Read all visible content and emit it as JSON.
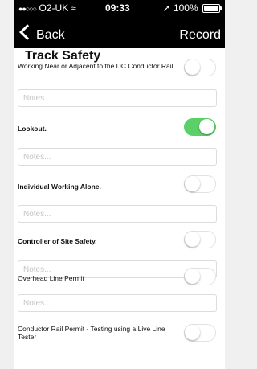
{
  "status_bar": {
    "signal_dots": "●●○○○",
    "carrier": "O2-UK",
    "wifi_glyph": "≈",
    "time": "09:33",
    "location_arrow": "➚",
    "battery": "100%"
  },
  "nav": {
    "back_label": "Back",
    "record_label": "Record"
  },
  "section": {
    "title": "Track Safety"
  },
  "items": [
    {
      "label": "Working Near or Adjacent to the DC Conductor Rail",
      "on": false,
      "notes_placeholder": "Notes..."
    },
    {
      "label": "Lookout.",
      "on": true,
      "notes_placeholder": "Notes..."
    },
    {
      "label": "Individual Working Alone.",
      "on": false,
      "notes_placeholder": "Notes..."
    },
    {
      "label": "Controller of Site Safety.",
      "on": false,
      "notes_placeholder": "Notes..."
    },
    {
      "label": "Overhead Line Permit",
      "on": false,
      "notes_placeholder": "Notes..."
    },
    {
      "label": "Conductor Rail Permit - Testing using a Live Line Tester",
      "on": false
    }
  ],
  "colors": {
    "toggle_on": "#5bd069",
    "header_bg": "#000000"
  }
}
